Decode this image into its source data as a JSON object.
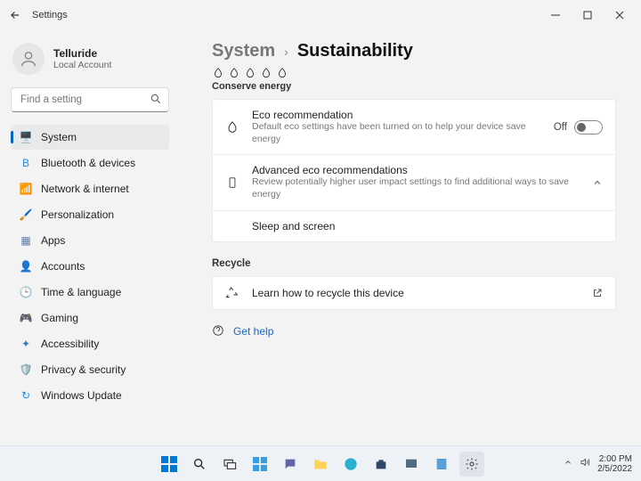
{
  "titlebar": {
    "app_title": "Settings"
  },
  "account": {
    "name": "Telluride",
    "type": "Local Account"
  },
  "search": {
    "placeholder": "Find a setting"
  },
  "sidebar": [
    {
      "label": "System",
      "icon": "🖥️",
      "color": "#3a87d6",
      "selected": true
    },
    {
      "label": "Bluetooth & devices",
      "icon": "B",
      "color": "#1e8ae6",
      "selected": false
    },
    {
      "label": "Network & internet",
      "icon": "📶",
      "color": "#0fb0d4",
      "selected": false
    },
    {
      "label": "Personalization",
      "icon": "🖌️",
      "color": "#d97a2e",
      "selected": false
    },
    {
      "label": "Apps",
      "icon": "▦",
      "color": "#5b7fa6",
      "selected": false
    },
    {
      "label": "Accounts",
      "icon": "👤",
      "color": "#c76a94",
      "selected": false
    },
    {
      "label": "Time & language",
      "icon": "🕒",
      "color": "#6d7a85",
      "selected": false
    },
    {
      "label": "Gaming",
      "icon": "🎮",
      "color": "#4aa564",
      "selected": false
    },
    {
      "label": "Accessibility",
      "icon": "✦",
      "color": "#2d7dc1",
      "selected": false
    },
    {
      "label": "Privacy & security",
      "icon": "🛡️",
      "color": "#526273",
      "selected": false
    },
    {
      "label": "Windows Update",
      "icon": "↻",
      "color": "#1e8ae6",
      "selected": false
    }
  ],
  "breadcrumb": {
    "parent": "System",
    "sep": "›",
    "current": "Sustainability"
  },
  "conserve": {
    "section": "Conserve energy",
    "eco": {
      "title": "Eco recommendation",
      "desc": "Default eco settings have been turned on to help your device save energy",
      "state": "Off"
    },
    "advanced": {
      "title": "Advanced eco recommendations",
      "desc": "Review potentially higher user impact settings to find additional ways to save energy"
    },
    "sleep": {
      "title": "Sleep and screen"
    }
  },
  "recycle": {
    "section": "Recycle",
    "learn": "Learn how to recycle this device"
  },
  "help": {
    "label": "Get help"
  },
  "tray": {
    "time": "2:00 PM",
    "date": "2/5/2022"
  }
}
